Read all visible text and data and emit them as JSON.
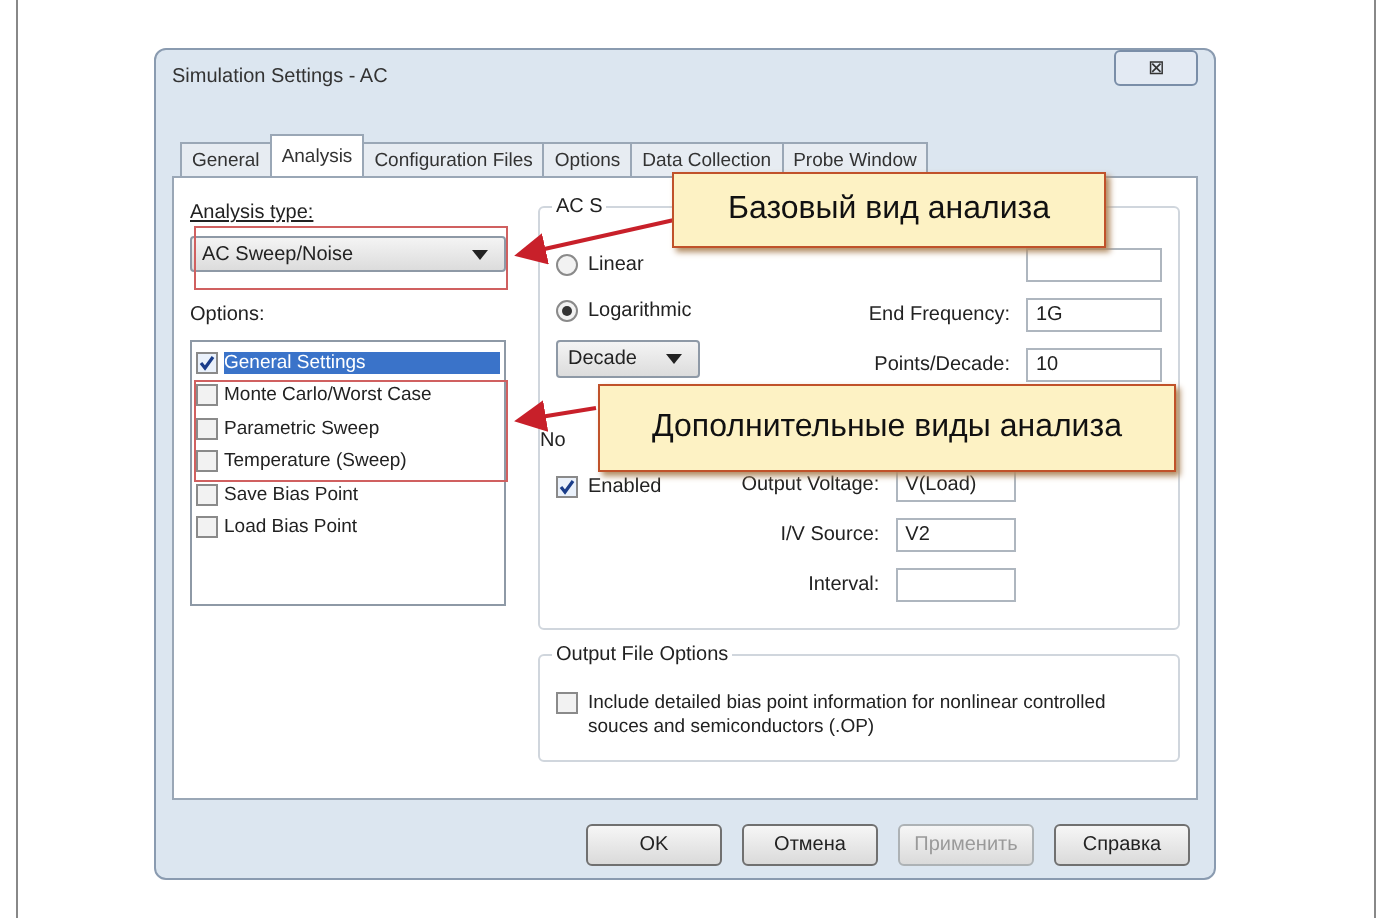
{
  "window": {
    "title": "Simulation Settings - AC",
    "close": "⊠"
  },
  "tabs": [
    {
      "label": "General",
      "selected": false
    },
    {
      "label": "Analysis",
      "selected": true
    },
    {
      "label": "Configuration Files",
      "selected": false
    },
    {
      "label": "Options",
      "selected": false
    },
    {
      "label": "Data Collection",
      "selected": false
    },
    {
      "label": "Probe Window",
      "selected": false
    }
  ],
  "analysis_type": {
    "label": "Analysis type:",
    "value": "AC Sweep/Noise"
  },
  "options": {
    "label": "Options:",
    "items": [
      {
        "label": "General Settings",
        "checked": true,
        "selected": true
      },
      {
        "label": "Monte Carlo/Worst Case",
        "checked": false,
        "selected": false
      },
      {
        "label": "Parametric Sweep",
        "checked": false,
        "selected": false
      },
      {
        "label": "Temperature (Sweep)",
        "checked": false,
        "selected": false
      },
      {
        "label": "Save Bias Point",
        "checked": false,
        "selected": false
      },
      {
        "label": "Load Bias Point",
        "checked": false,
        "selected": false
      }
    ]
  },
  "ac_sweep": {
    "title": "AC S",
    "radios": [
      {
        "label": "Linear",
        "selected": false
      },
      {
        "label": "Logarithmic",
        "selected": true
      }
    ],
    "scale": "Decade",
    "fields": [
      {
        "label": "End Frequency:",
        "value": "1G"
      },
      {
        "label": "Points/Decade:",
        "value": "10"
      }
    ]
  },
  "noise": {
    "title": "No",
    "enabled": {
      "label": "Enabled",
      "checked": true
    },
    "fields": [
      {
        "label": "Output Voltage:",
        "value": "V(Load)"
      },
      {
        "label": "I/V Source:",
        "value": "V2"
      },
      {
        "label": "Interval:"
      }
    ]
  },
  "output_file": {
    "title": "Output File Options",
    "checkbox": {
      "label": "Include detailed bias point information for nonlinear controlled souces and semiconductors (.OP)",
      "checked": false
    }
  },
  "buttons": [
    {
      "label": "OK",
      "disabled": false
    },
    {
      "label": "Отмена",
      "disabled": false
    },
    {
      "label": "Применить",
      "disabled": true
    },
    {
      "label": "Справка",
      "disabled": false
    }
  ],
  "callouts": [
    "Базовый вид анализа",
    "Дополнительные виды анализа"
  ]
}
